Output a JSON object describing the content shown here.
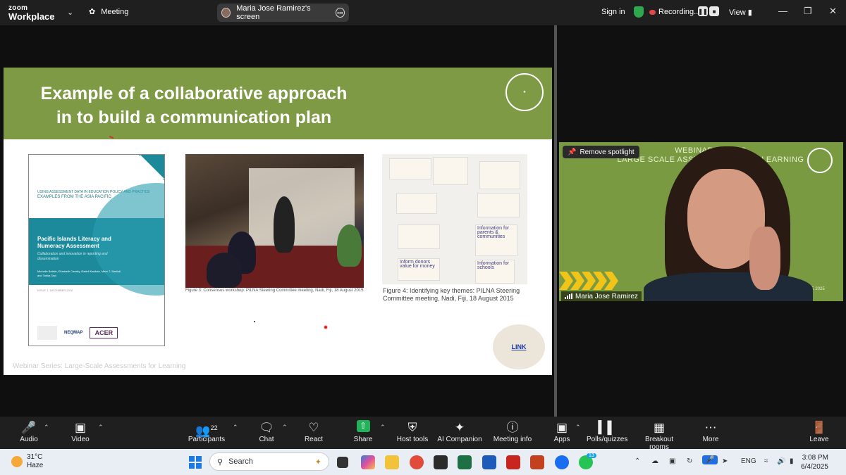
{
  "topbar": {
    "logo_line1": "zoom",
    "logo_line2": "Workplace",
    "meeting_label": "Meeting",
    "screen_share_label": "Maria Jose Ramirez's screen",
    "sign_in": "Sign in",
    "recording": "Recording...",
    "view": "View"
  },
  "slide": {
    "title_line1": "Example of a collaborative approach",
    "title_line2": "in to build a communication plan",
    "cover": {
      "top_text_1": "USING ASSESSMENT DATA IN EDUCATION POLICY AND PRACTICE",
      "top_text_2": "EXAMPLES FROM THE ASIA PACIFIC",
      "title": "Pacific Islands Literacy and Numeracy Assessment",
      "subtitle": "Collaboration and innovation in reporting and dissemination",
      "authors": "Michelle Belisle, Elizabeth Cassity, Ratieli Kacilala, Mere T. Seniloli and Torika Taoi",
      "issue": "ISSUE 1, DECEMBER 2016",
      "logo_neqmap": "NEQMAP",
      "logo_acer": "ACER"
    },
    "caption1": "Figure 3: Consensus workshop: PILNA Steering Committee meeting, Nadi, Fiji, 18 August 2015",
    "caption2": "Figure 4: Identifying key themes: PILNA Steering Committee meeting, Nadi, Fiji, 18 August 2015",
    "notes": [
      "Information for parents & communities",
      "Information for schools",
      "Inform donors value for money"
    ],
    "link": "LINK",
    "footer": "Webinar Series: Large-Scale Assessments for Learning"
  },
  "video": {
    "remove_spotlight": "Remove spotlight",
    "banner_line1": "WEBINAR SERIES",
    "banner_line2": "LARGE SCALE ASSESSMENTS FOR LEARNING",
    "date": "4th JUNE 2025",
    "participant_name": "Maria Jose Ramirez"
  },
  "toolbar": {
    "audio": "Audio",
    "video": "Video",
    "participants": "Participants",
    "participants_count": "22",
    "chat": "Chat",
    "react": "React",
    "share": "Share",
    "host_tools": "Host tools",
    "ai_companion": "AI Companion",
    "meeting_info": "Meeting info",
    "apps": "Apps",
    "polls": "Polls/quizzes",
    "breakout": "Breakout rooms",
    "more": "More",
    "leave": "Leave"
  },
  "taskbar": {
    "temperature": "31°C",
    "weather": "Haze",
    "search_placeholder": "Search",
    "language": "ENG",
    "time": "3:08 PM",
    "date": "6/4/2025",
    "whatsapp_badge": "13"
  },
  "colors": {
    "slide_green": "#7f9a44",
    "share_green": "#23b25a",
    "record_red": "#e04848"
  }
}
